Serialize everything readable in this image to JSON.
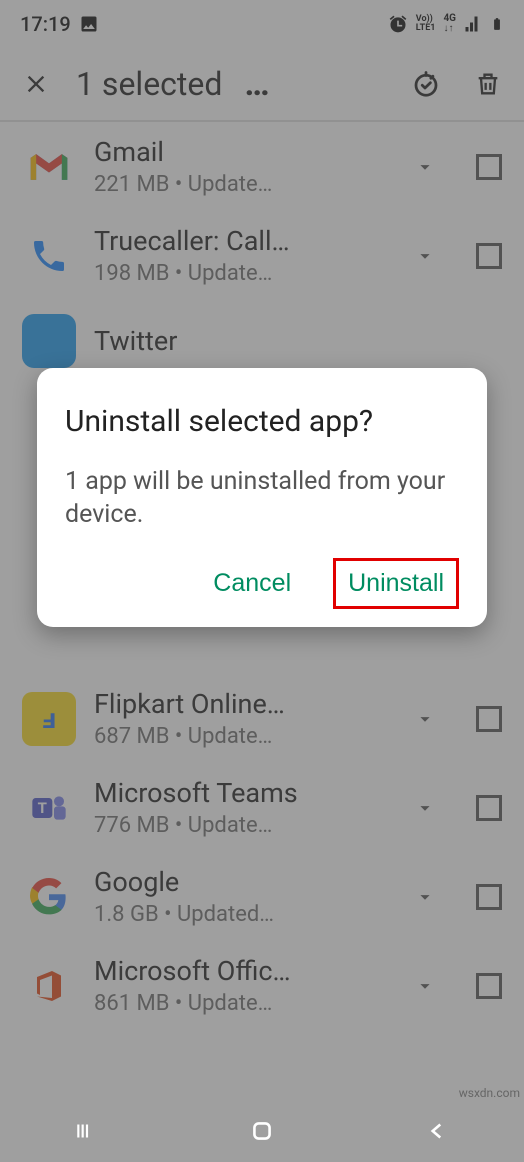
{
  "status": {
    "time": "17:19"
  },
  "header": {
    "title": "1 selected"
  },
  "apps": [
    {
      "name": "Gmail",
      "meta": "221 MB  •  Update…",
      "icon": "gmail"
    },
    {
      "name": "Truecaller: Call…",
      "meta": "198 MB  •  Update…",
      "icon": "truecaller"
    },
    {
      "name": "Twitter",
      "meta": "",
      "icon": "twitter"
    },
    {
      "name": "Flipkart Online…",
      "meta": "687 MB  •  Update…",
      "icon": "flipkart"
    },
    {
      "name": "Microsoft Teams",
      "meta": "776 MB  •  Update…",
      "icon": "teams"
    },
    {
      "name": "Google",
      "meta": "1.8 GB  •  Updated…",
      "icon": "google"
    },
    {
      "name": "Microsoft Offic…",
      "meta": "861 MB  •  Update…",
      "icon": "office"
    }
  ],
  "dialog": {
    "title": "Uninstall selected app?",
    "body": "1 app will be uninstalled from your device.",
    "cancel": "Cancel",
    "confirm": "Uninstall"
  },
  "watermark": "wsxdn.com"
}
